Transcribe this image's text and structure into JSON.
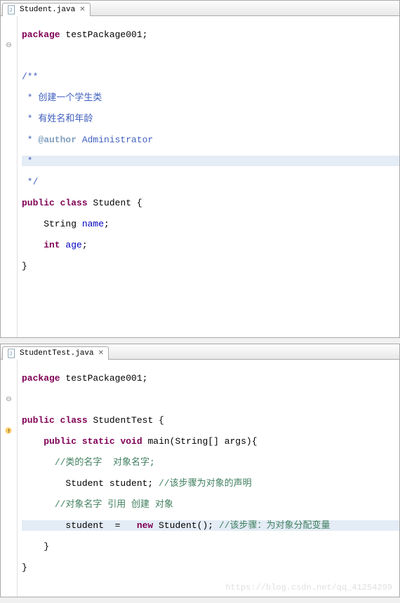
{
  "pane1": {
    "tab": {
      "title": "Student.java",
      "icon": "java-file-icon"
    },
    "code": {
      "l1": {
        "kw": "package",
        "pkg": " testPackage001;"
      },
      "l2": "",
      "l3": "/**",
      "l4_pre": " * ",
      "l4_txt": "创建一个学生类",
      "l5_pre": " * ",
      "l5_txt": "有姓名和年龄",
      "l6_pre": " * ",
      "l6_tag": "@author",
      "l6_val": " Administrator",
      "l7": " *",
      "l8": " */",
      "l9_kw1": "public",
      "l9_kw2": "class",
      "l9_name": " Student {",
      "l10_type": "    String ",
      "l10_name": "name",
      "l10_end": ";",
      "l11_kw": "    int",
      "l11_name": " age",
      "l11_end": ";",
      "l12": "}"
    }
  },
  "pane2": {
    "tab": {
      "title": "StudentTest.java",
      "icon": "java-file-icon"
    },
    "code": {
      "l1": {
        "kw": "package",
        "pkg": " testPackage001;"
      },
      "l2": "",
      "l3_kw1": "public",
      "l3_kw2": "class",
      "l3_name": " StudentTest {",
      "l4_kw1": "    public",
      "l4_kw2": "static",
      "l4_kw3": "void",
      "l4_name": " main(String[] args){",
      "l5_ind": "      ",
      "l5_cm": "//类的名字  对象名字;",
      "l6_txt": "        Student student; ",
      "l6_cm": "//该步骤为对象的声明",
      "l7_ind": "      ",
      "l7_cm": "//对象名字 引用 创建 对象",
      "l8_a": "        student  =   ",
      "l8_kw": "new",
      "l8_b": " Student(); ",
      "l8_cm": "//该步骤：为对象分配变量",
      "l9": "    }",
      "l10": "}"
    }
  },
  "watermark": "https://blog.csdn.net/qq_41254299"
}
